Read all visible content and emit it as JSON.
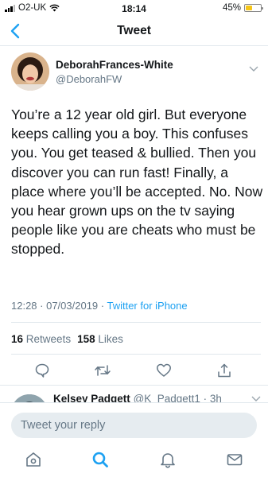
{
  "status_bar": {
    "carrier": "O2-UK",
    "time": "18:14",
    "battery": "45%",
    "battery_level": 0.45
  },
  "nav": {
    "title": "Tweet",
    "back_icon": "chevron-left-icon"
  },
  "tweet": {
    "author_name": "DeborahFrances-White",
    "author_handle": "@DeborahFW",
    "text": "You’re a 12 year old girl. But everyone keeps calling you a boy. This confuses you. You get teased & bullied. Then you discover you can run fast! Finally, a place where you’ll be accepted. No. Now you hear grown ups on the tv saying people like you are cheats who must be stopped.",
    "timestamp": "12:28 · 07/03/2019 · ",
    "source": "Twitter for iPhone",
    "retweets_count": "16",
    "retweets_label": "Retweets",
    "likes_count": "158",
    "likes_label": "Likes"
  },
  "actions": [
    {
      "name": "reply",
      "icon": "comment-icon"
    },
    {
      "name": "retweet",
      "icon": "retweet-icon"
    },
    {
      "name": "like",
      "icon": "heart-icon"
    },
    {
      "name": "share",
      "icon": "share-icon"
    }
  ],
  "reply_preview": {
    "name": "Kelsey Padgett",
    "handle": "@K_Padgett1 · 3h"
  },
  "composer": {
    "placeholder": "Tweet your reply"
  },
  "tab_bar": [
    {
      "name": "home",
      "icon": "home-icon"
    },
    {
      "name": "search",
      "icon": "search-icon",
      "active": true
    },
    {
      "name": "notifications",
      "icon": "bell-icon"
    },
    {
      "name": "messages",
      "icon": "mail-icon"
    }
  ],
  "colors": {
    "accent": "#1da1f2",
    "text": "#14171a",
    "secondary": "#657786",
    "divider": "#e1e8ed",
    "battery": "#f5c518"
  }
}
